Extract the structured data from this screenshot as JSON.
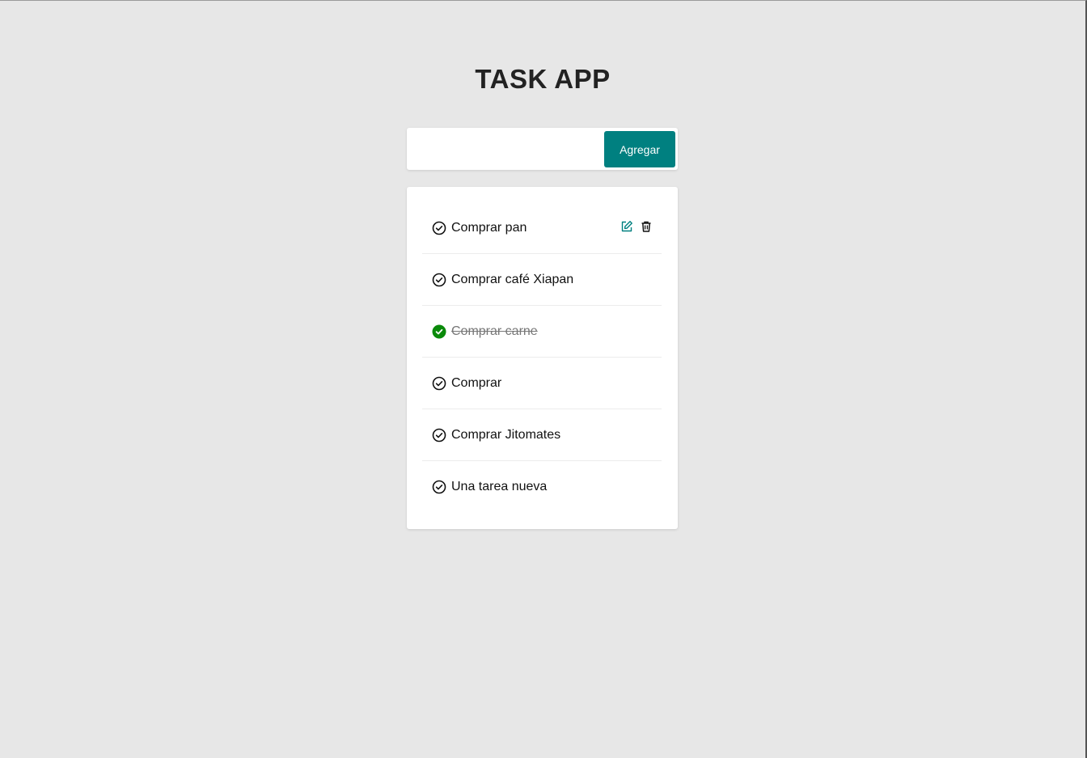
{
  "app": {
    "title": "TASK APP"
  },
  "form": {
    "input_value": "",
    "add_label": "Agregar"
  },
  "tasks": [
    {
      "text": "Comprar pan",
      "done": false
    },
    {
      "text": "Comprar café Xiapan",
      "done": false
    },
    {
      "text": "Comprar carne",
      "done": true
    },
    {
      "text": "Comprar",
      "done": false
    },
    {
      "text": "Comprar Jitomates",
      "done": false
    },
    {
      "text": "Una tarea nueva",
      "done": false
    }
  ],
  "icons": {
    "check": "check-circle-icon",
    "done": "check-circle-filled-icon",
    "edit": "edit-icon",
    "delete": "trash-icon"
  },
  "colors": {
    "accent": "#008080",
    "done": "#0a8a0a",
    "background": "#e7e7e7"
  }
}
